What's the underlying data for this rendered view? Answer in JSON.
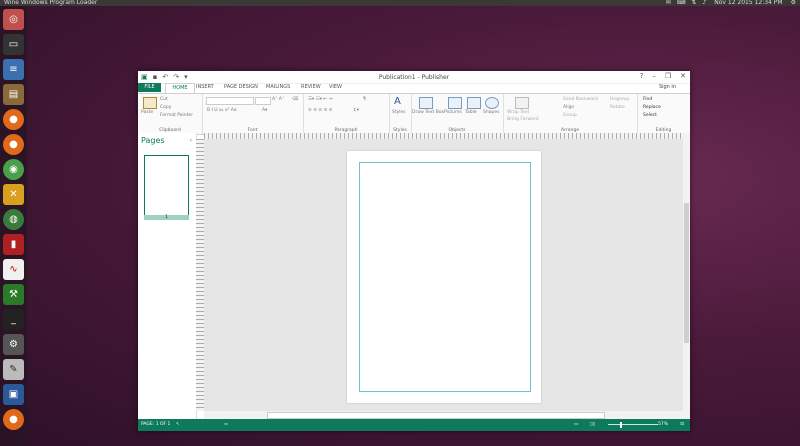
{
  "topbar": {
    "title": "Wine Windows Program Loader",
    "datetime": "Nov 12 2015 12:34 PM"
  },
  "launcher": {
    "icons": [
      "dash-icon",
      "terminal-icon",
      "text-editor-icon",
      "files-icon",
      "firefox-icon",
      "firefox-icon",
      "chrome-icon",
      "crossover-icon",
      "globe-icon",
      "pdf-icon",
      "gimp-icon",
      "wine-icon",
      "terminal-icon",
      "settings-icon",
      "text-editor-icon",
      "image-viewer-icon",
      "firefox-icon"
    ]
  },
  "window": {
    "title": "Publication1 - Publisher",
    "help": "?",
    "signin": "Sign in",
    "tabs": [
      "FILE",
      "HOME",
      "INSERT",
      "PAGE DESIGN",
      "MAILINGS",
      "REVIEW",
      "VIEW"
    ],
    "ribbon": {
      "clipboard": {
        "paste": "Paste",
        "cut": "Cut",
        "copy": "Copy",
        "format_painter": "Format Painter",
        "label": "Clipboard"
      },
      "font": {
        "label": "Font"
      },
      "paragraph": {
        "label": "Paragraph"
      },
      "styles": {
        "button": "Styles",
        "label": "Styles"
      },
      "objects": {
        "draw_text_box": "Draw Text Box",
        "pictures": "Pictures",
        "table": "Table",
        "shapes": "Shapes",
        "label": "Objects"
      },
      "arrange": {
        "wrap_text": "Wrap Text",
        "bring_forward": "Bring Forward",
        "send_backward": "Send Backward",
        "align": "Align",
        "group": "Group",
        "ungroup": "Ungroup",
        "rotate": "Rotate",
        "label": "Arrange"
      },
      "editing": {
        "find": "Find",
        "replace": "Replace",
        "select": "Select",
        "label": "Editing"
      }
    },
    "pages_pane": {
      "title": "Pages",
      "page_num": "1"
    },
    "status": {
      "page": "PAGE: 1 OF 1",
      "zoom": "57%"
    }
  }
}
